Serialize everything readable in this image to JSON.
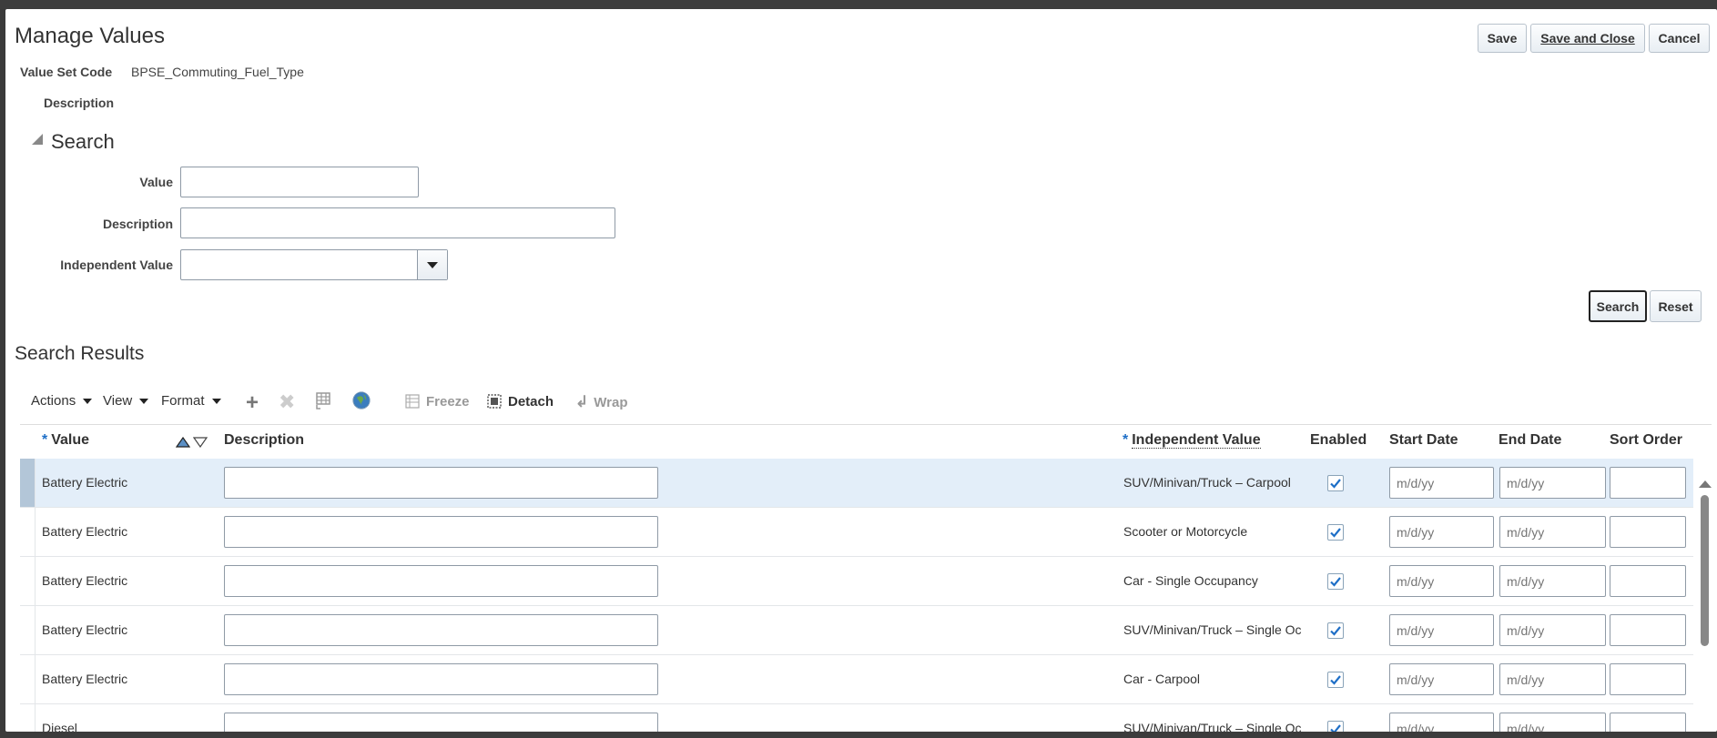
{
  "header": {
    "title": "Manage Values",
    "save_label": "Save",
    "save_close_label": "Save and Close",
    "cancel_label": "Cancel"
  },
  "info": {
    "value_set_code_label": "Value Set Code",
    "value_set_code": "BPSE_Commuting_Fuel_Type",
    "description_label": "Description",
    "description": ""
  },
  "search": {
    "title": "Search",
    "value_label": "Value",
    "value": "",
    "description_label": "Description",
    "description": "",
    "independent_value_label": "Independent Value",
    "independent_value": "",
    "search_label": "Search",
    "reset_label": "Reset"
  },
  "results": {
    "title": "Search Results",
    "toolbar": {
      "actions": "Actions",
      "view": "View",
      "format": "Format",
      "freeze": "Freeze",
      "detach": "Detach",
      "wrap": "Wrap"
    },
    "columns": {
      "value": "Value",
      "description": "Description",
      "independent_value": "Independent Value",
      "enabled": "Enabled",
      "start_date": "Start Date",
      "end_date": "End Date",
      "sort_order": "Sort Order"
    },
    "date_placeholder": "m/d/yy",
    "rows": [
      {
        "value": "Battery Electric",
        "description": "",
        "independent_value": "SUV/Minivan/Truck – Carpool",
        "enabled": true,
        "start_date": "",
        "end_date": "",
        "sort_order": ""
      },
      {
        "value": "Battery Electric",
        "description": "",
        "independent_value": "Scooter or Motorcycle",
        "enabled": true,
        "start_date": "",
        "end_date": "",
        "sort_order": ""
      },
      {
        "value": "Battery Electric",
        "description": "",
        "independent_value": "Car - Single Occupancy",
        "enabled": true,
        "start_date": "",
        "end_date": "",
        "sort_order": ""
      },
      {
        "value": "Battery Electric",
        "description": "",
        "independent_value": "SUV/Minivan/Truck – Single Occupancy",
        "enabled": true,
        "start_date": "",
        "end_date": "",
        "sort_order": ""
      },
      {
        "value": "Battery Electric",
        "description": "",
        "independent_value": "Car - Carpool",
        "enabled": true,
        "start_date": "",
        "end_date": "",
        "sort_order": ""
      },
      {
        "value": "Diesel",
        "description": "",
        "independent_value": "SUV/Minivan/Truck – Single Occupancy",
        "enabled": true,
        "start_date": "",
        "end_date": "",
        "sort_order": ""
      }
    ]
  },
  "colors": {
    "accent": "#1e6fc7",
    "selected_row": "#e3eef9",
    "row_marker": "#b3c6d8"
  }
}
